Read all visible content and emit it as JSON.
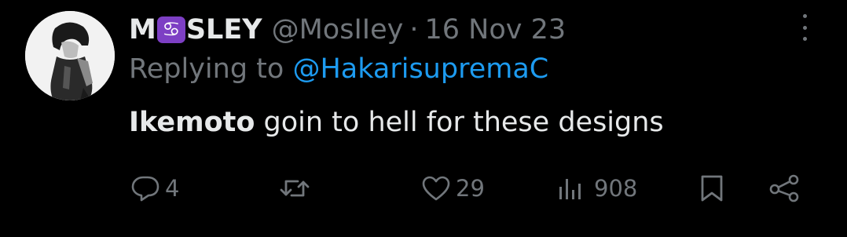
{
  "tweet": {
    "display_name_prefix": "M",
    "zodiac_symbol": "♋",
    "display_name_suffix": "SLEY",
    "handle": "@MosIIey",
    "separator": "·",
    "date": "16 Nov 23",
    "replying_label": "Replying to",
    "replying_to": "@HakarisupremaC",
    "text_bold": "Ikemoto",
    "text_rest": " goin to hell for these designs"
  },
  "actions": {
    "replies": "4",
    "likes": "29",
    "views": "908"
  },
  "colors": {
    "background": "#000000",
    "text": "#e7e9ea",
    "muted": "#71767b",
    "link": "#1d9bf0",
    "zodiac_badge": "#7d3fc4"
  },
  "icons": [
    "reply-icon",
    "retweet-icon",
    "like-icon",
    "views-icon",
    "bookmark-icon",
    "share-icon",
    "more-icon"
  ]
}
